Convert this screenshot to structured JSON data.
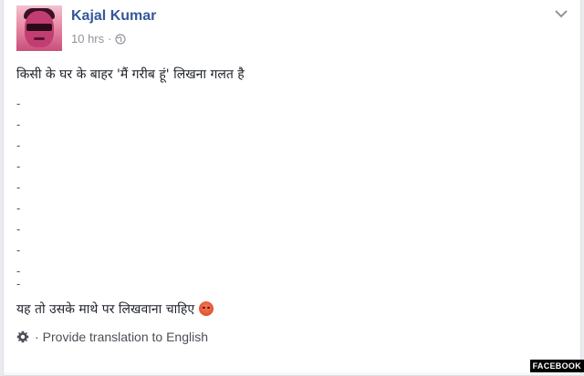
{
  "post": {
    "author": "Kajal Kumar",
    "time": "10 hrs",
    "separator": "·",
    "privacy_icon": "globe-icon",
    "line1": "किसी के घर के बाहर 'मैं गरीब हूं' लिखना गलत है",
    "dash_lines": [
      "-",
      "-",
      "-",
      "-",
      "-",
      "-",
      "-",
      "-",
      "-",
      "-"
    ],
    "line2": "यह तो उसके माथे पर लिखवाना चाहिए",
    "emoji_icon": "angry-face-icon"
  },
  "translation": {
    "separator": "·",
    "label": "Provide translation to English"
  },
  "watermark": "FACEBOOK",
  "colors": {
    "name": "#365899",
    "meta": "#90949c",
    "text": "#1d2129",
    "background": "#e9ebee"
  }
}
